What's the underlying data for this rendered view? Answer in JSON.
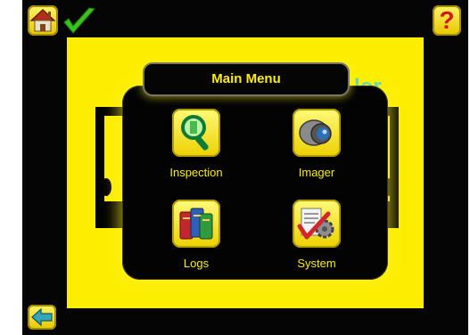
{
  "header": {
    "home_icon": "home-icon",
    "status_icon": "pass-checkmark-icon",
    "help_symbol": "?",
    "help_icon": "help-icon"
  },
  "background": {
    "partial_text": "lor"
  },
  "menu": {
    "title": "Main Menu",
    "items": [
      {
        "label": "Inspection",
        "icon": "inspection-magnifier-icon"
      },
      {
        "label": "Imager",
        "icon": "camera-lens-icon"
      },
      {
        "label": "Logs",
        "icon": "logs-books-icon"
      },
      {
        "label": "System",
        "icon": "system-settings-icon"
      }
    ]
  },
  "footer": {
    "back_icon": "back-arrow-icon"
  },
  "colors": {
    "accent": "#fdee00",
    "screen_background": "#050505",
    "pass": "#3cc21e",
    "help": "#d11a1a",
    "background_text": "#19d0ee"
  }
}
